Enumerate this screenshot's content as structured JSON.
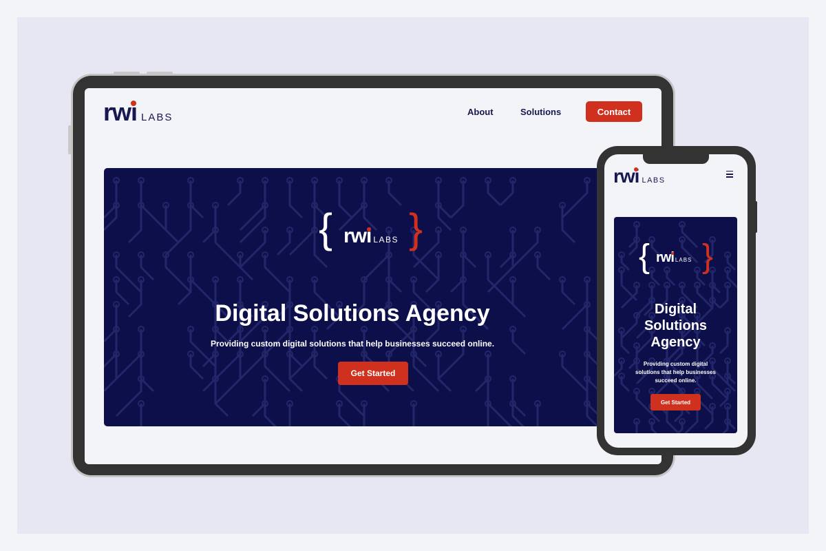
{
  "brand": {
    "wordmark": "rwi",
    "suffix": "LABS",
    "navy": "#17184f",
    "accent_red": "#d0311f",
    "hero_background": "#0d0f4a"
  },
  "tablet": {
    "nav": {
      "about": "About",
      "solutions": "Solutions",
      "contact": "Contact"
    },
    "hero": {
      "brace_open": "{",
      "brace_close": "}",
      "title": "Digital Solutions Agency",
      "subtitle": "Providing custom digital solutions that help businesses succeed online.",
      "cta": "Get Started"
    }
  },
  "phone": {
    "menu_icon": "hamburger-menu-icon",
    "hero": {
      "brace_open": "{",
      "brace_close": "}",
      "title_lines": [
        "Digital",
        "Solutions",
        "Agency"
      ],
      "subtitle_lines": [
        "Providing custom digital",
        "solutions that help businesses",
        "succeed online."
      ],
      "cta": "Get Started"
    }
  }
}
